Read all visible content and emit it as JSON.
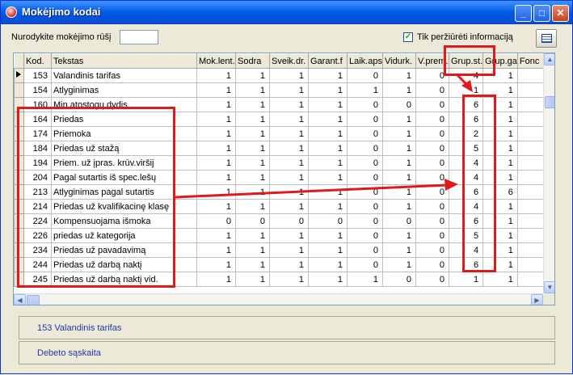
{
  "window": {
    "title": "Mokėjimo kodai"
  },
  "filter": {
    "label": "Nurodykite mokėjimo rūšį",
    "value": "",
    "checkbox_label": "Tik peržiūrėti informaciją",
    "checkbox_checked": true
  },
  "columns": [
    "Kod.",
    "Tekstas",
    "Mok.lent.",
    "Sodra",
    "Sveik.dr.",
    "Garant.f",
    "Laik.aps",
    "Vidurk.",
    "V.prem.",
    "Grup.st.",
    "Grup.ga",
    "Fonc"
  ],
  "rows": [
    {
      "code": "153",
      "text": "Valandinis tarifas",
      "vals": [
        "1",
        "1",
        "1",
        "1",
        "0",
        "1",
        "0",
        "4",
        "1"
      ]
    },
    {
      "code": "154",
      "text": "Atlyginimas",
      "vals": [
        "1",
        "1",
        "1",
        "1",
        "1",
        "1",
        "0",
        "1",
        "1"
      ]
    },
    {
      "code": "160",
      "text": "Min.atostogų dydis",
      "vals": [
        "1",
        "1",
        "1",
        "1",
        "0",
        "0",
        "0",
        "6",
        "1"
      ]
    },
    {
      "code": "164",
      "text": "Priedas",
      "vals": [
        "1",
        "1",
        "1",
        "1",
        "0",
        "1",
        "0",
        "6",
        "1"
      ]
    },
    {
      "code": "174",
      "text": "Priemoka",
      "vals": [
        "1",
        "1",
        "1",
        "1",
        "0",
        "1",
        "0",
        "2",
        "1"
      ]
    },
    {
      "code": "184",
      "text": "Priedas už stažą",
      "vals": [
        "1",
        "1",
        "1",
        "1",
        "0",
        "1",
        "0",
        "5",
        "1"
      ]
    },
    {
      "code": "194",
      "text": "Priem. už įpras. krūv.viršij",
      "vals": [
        "1",
        "1",
        "1",
        "1",
        "0",
        "1",
        "0",
        "4",
        "1"
      ]
    },
    {
      "code": "204",
      "text": "Pagal sutartis iš spec.lešų",
      "vals": [
        "1",
        "1",
        "1",
        "1",
        "0",
        "1",
        "0",
        "4",
        "1"
      ]
    },
    {
      "code": "213",
      "text": "Atlyginimas pagal sutartis",
      "vals": [
        "1",
        "1",
        "1",
        "1",
        "0",
        "1",
        "0",
        "6",
        "6"
      ]
    },
    {
      "code": "214",
      "text": "Priedas už kvalifikacinę klasę",
      "vals": [
        "1",
        "1",
        "1",
        "1",
        "0",
        "1",
        "0",
        "4",
        "1"
      ]
    },
    {
      "code": "224",
      "text": "Kompensuojama išmoka",
      "vals": [
        "0",
        "0",
        "0",
        "0",
        "0",
        "0",
        "0",
        "6",
        "1"
      ]
    },
    {
      "code": "226",
      "text": "priedas už kategorija",
      "vals": [
        "1",
        "1",
        "1",
        "1",
        "0",
        "1",
        "0",
        "5",
        "1"
      ]
    },
    {
      "code": "234",
      "text": "Priedas už pavadavimą",
      "vals": [
        "1",
        "1",
        "1",
        "1",
        "0",
        "1",
        "0",
        "4",
        "1"
      ]
    },
    {
      "code": "244",
      "text": "Priedas už darbą naktį",
      "vals": [
        "1",
        "1",
        "1",
        "1",
        "0",
        "1",
        "0",
        "6",
        "1"
      ]
    },
    {
      "code": "245",
      "text": "Priedas už darbą naktį vid.",
      "vals": [
        "1",
        "1",
        "1",
        "1",
        "1",
        "0",
        "0",
        "1",
        "1"
      ]
    }
  ],
  "status": {
    "selected": "153 Valandinis tarifas",
    "account": "Debeto sąskaita"
  },
  "colors": {
    "highlight": "#e0191b",
    "titlebar": "#0054e3"
  }
}
